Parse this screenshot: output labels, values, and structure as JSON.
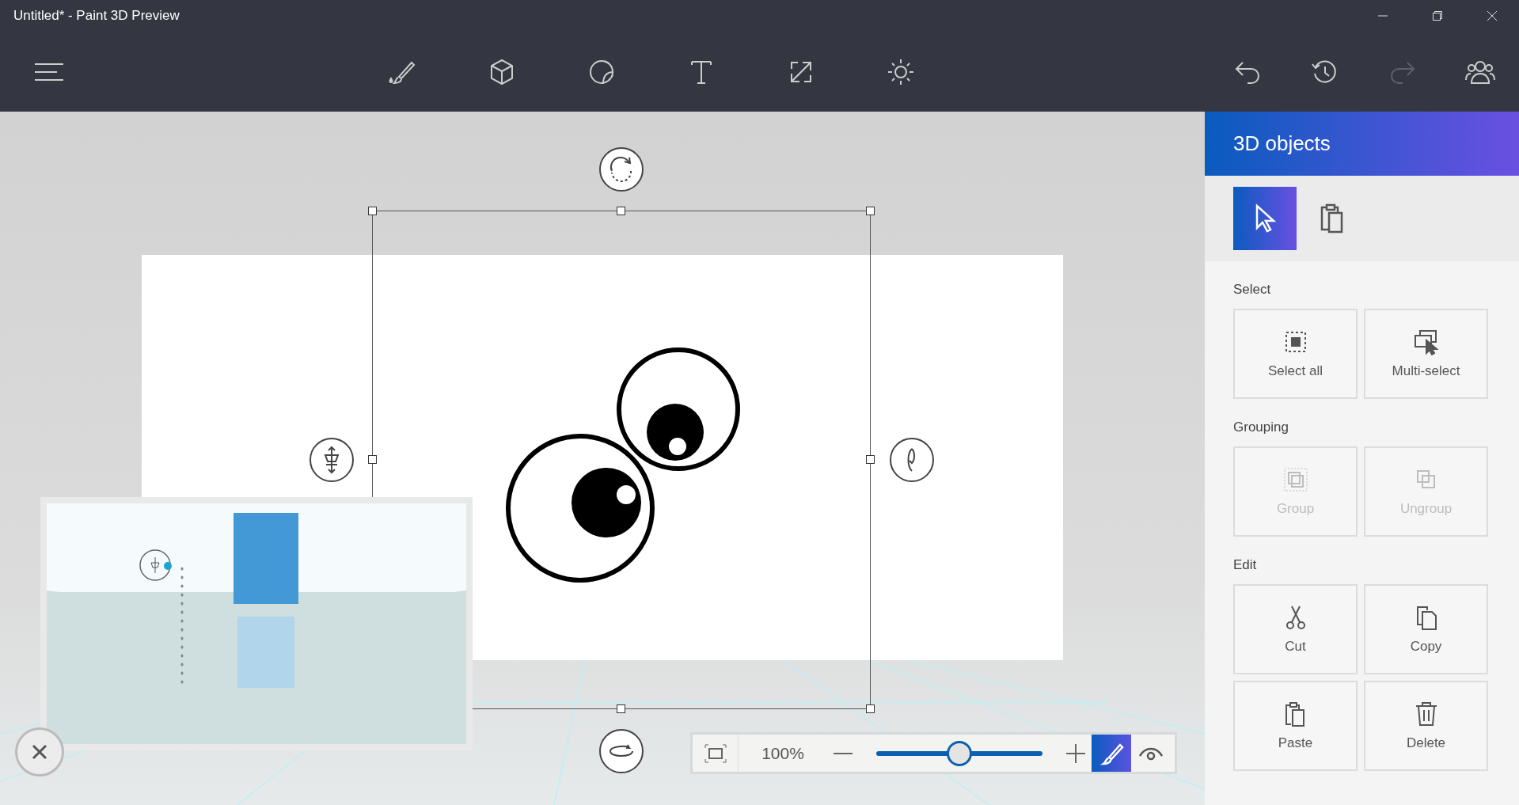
{
  "window": {
    "title": "Untitled* - Paint 3D Preview"
  },
  "toolbar": {
    "tools": [
      {
        "kind": "brush"
      },
      {
        "kind": "cube"
      },
      {
        "kind": "sticker"
      },
      {
        "kind": "text"
      },
      {
        "kind": "canvas"
      },
      {
        "kind": "effects"
      }
    ],
    "history": [
      {
        "kind": "undo",
        "disabled": false
      },
      {
        "kind": "history",
        "disabled": false
      },
      {
        "kind": "redo",
        "disabled": true
      },
      {
        "kind": "people",
        "disabled": false
      }
    ]
  },
  "panel": {
    "title": "3D objects",
    "modes": [
      {
        "kind": "select",
        "selected": true
      },
      {
        "kind": "paste",
        "selected": false
      }
    ],
    "sections": [
      {
        "title": "Select",
        "actions": [
          {
            "kind": "select-all",
            "label": "Select all",
            "disabled": false
          },
          {
            "kind": "multi-select",
            "label": "Multi-select",
            "disabled": false
          }
        ]
      },
      {
        "title": "Grouping",
        "actions": [
          {
            "kind": "group",
            "label": "Group",
            "disabled": true
          },
          {
            "kind": "ungroup",
            "label": "Ungroup",
            "disabled": true
          }
        ]
      },
      {
        "title": "Edit",
        "actions": [
          {
            "kind": "cut",
            "label": "Cut",
            "disabled": false
          },
          {
            "kind": "copy",
            "label": "Copy",
            "disabled": false
          },
          {
            "kind": "paste",
            "label": "Paste",
            "disabled": false
          },
          {
            "kind": "delete",
            "label": "Delete",
            "disabled": false
          }
        ]
      }
    ]
  },
  "zoom": {
    "value": "100%",
    "level": 0.5,
    "views": [
      {
        "kind": "brush",
        "selected": true
      },
      {
        "kind": "eye",
        "selected": false
      }
    ]
  }
}
